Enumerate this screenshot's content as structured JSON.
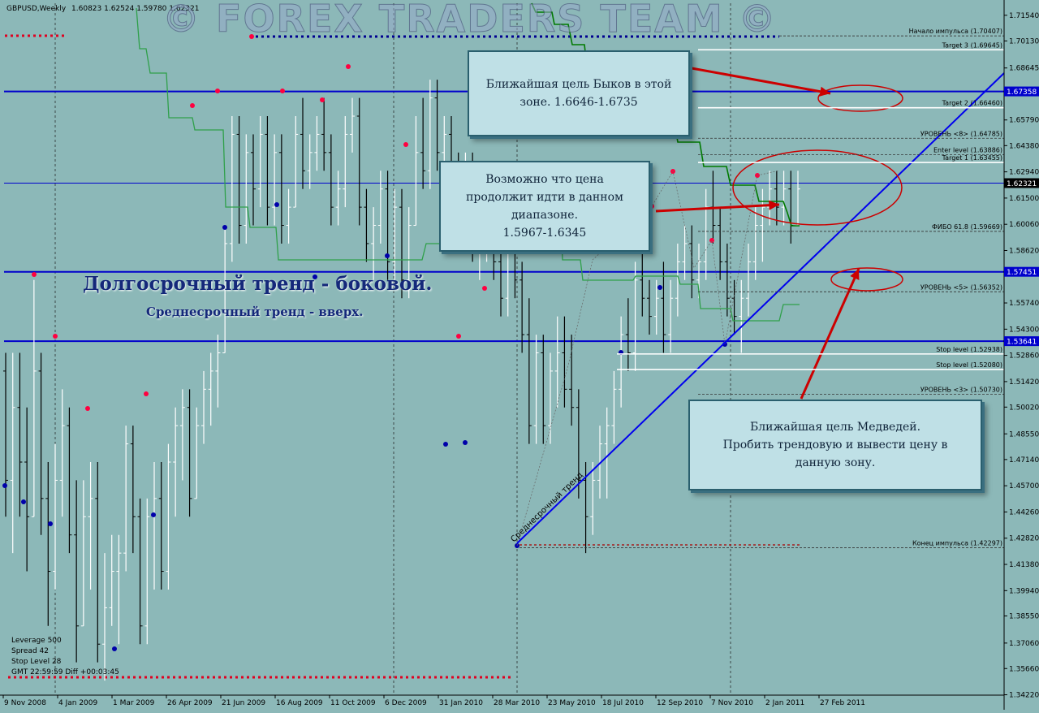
{
  "header": {
    "symbol": "GBPUSD,Weekly",
    "ohlc": "1.60823 1.62524 1.59780 1.62321",
    "watermark": "© FOREX TRADERS TEAM ©"
  },
  "info_panel": [
    "Leverage 500",
    "Spread 42",
    "Stop Level 28",
    "GMT 22:59:59 Diff +00:03:45"
  ],
  "annotations": {
    "long_term": "Долгосрочный тренд - боковой.",
    "mid_term": "Среднесрочный тренд - вверх.",
    "trend_label": "Среднесрочный тренд",
    "callout_bulls": [
      "Ближайшая цель Быков в этой",
      "зоне. 1.6646-1.6735"
    ],
    "callout_range": [
      "Возможно что цена",
      "продолжит идти в данном",
      "диапазоне.",
      "1.5967-1.6345"
    ],
    "callout_bears": [
      "Ближайшая цель Медведей.",
      "Пробить трендовую и вывести цену в",
      "данную зону."
    ]
  },
  "colors": {
    "background": "#8cb8b8",
    "level_line": "#0000cc",
    "trend_line": "#0000ee",
    "green_line": "#2fa04a",
    "dark_green": "#007a00",
    "red_dot": "#ff0040",
    "arrow": "#cc0000",
    "current_price_bg": "#000080"
  },
  "chart_data": {
    "type": "bar",
    "ylim": [
      1.342,
      1.722
    ],
    "y_ticks": [
      "1.71540",
      "1.70130",
      "1.68645",
      "1.67358",
      "1.65790",
      "1.64380",
      "1.62940",
      "1.62321",
      "1.61500",
      "1.60060",
      "1.58620",
      "1.57451",
      "1.55740",
      "1.54300",
      "1.53641",
      "1.52860",
      "1.51420",
      "1.50020",
      "1.48550",
      "1.47140",
      "1.45700",
      "1.44260",
      "1.42820",
      "1.41380",
      "1.39940",
      "1.38550",
      "1.37060",
      "1.35660",
      "1.34220"
    ],
    "x_ticks": [
      "9 Nov 2008",
      "4 Jan 2009",
      "1 Mar 2009",
      "26 Apr 2009",
      "21 Jun 2009",
      "16 Aug 2009",
      "11 Oct 2009",
      "6 Dec 2009",
      "31 Jan 2010",
      "28 Mar 2010",
      "23 May 2010",
      "18 Jul 2010",
      "12 Sep 2010",
      "7 Nov 2010",
      "2 Jan 2011",
      "27 Feb 2011"
    ],
    "price_boxes": [
      {
        "value": 1.67358,
        "label": "1.67358"
      },
      {
        "value": 1.62321,
        "label": "1.62321"
      },
      {
        "value": 1.57451,
        "label": "1.57451"
      },
      {
        "value": 1.53641,
        "label": "1.53641"
      }
    ],
    "horizontal_levels": [
      {
        "value": 1.67358,
        "style": "solid-blue"
      },
      {
        "value": 1.57451,
        "style": "solid-blue"
      },
      {
        "value": 1.53641,
        "style": "solid-blue"
      },
      {
        "value": 1.62321,
        "style": "thin-blue"
      }
    ],
    "fib_levels": [
      {
        "value": 1.70407,
        "label": "Начало импульса",
        "price": "(1.70407)"
      },
      {
        "value": 1.69645,
        "label": "Target 3",
        "price": "(1.69645)"
      },
      {
        "value": 1.6646,
        "label": "Target 2",
        "price": "(1.66460)"
      },
      {
        "value": 1.64785,
        "label": "УРОВЕНЬ <8>",
        "price": "(1.64785)"
      },
      {
        "value": 1.63886,
        "label": "Enter level",
        "price": "(1.63886)"
      },
      {
        "value": 1.63455,
        "label": "Target 1",
        "price": "(1.63455)"
      },
      {
        "value": 1.59669,
        "label": "ФИБО 61.8",
        "price": "(1.59669)"
      },
      {
        "value": 1.56352,
        "label": "УРОВЕНЬ <5>",
        "price": "(1.56352)"
      },
      {
        "value": 1.52938,
        "label": "Stop level",
        "price": "(1.52938)"
      },
      {
        "value": 1.5208,
        "label": "Stop level",
        "price": "(1.52080)"
      },
      {
        "value": 1.5073,
        "label": "УРОВЕНЬ <3>",
        "price": "(1.50730)"
      },
      {
        "value": 1.42297,
        "label": "Конец импульса",
        "price": "(1.42297)"
      }
    ],
    "ohlc_bars": [
      [
        1.52,
        1.53,
        1.44,
        1.46
      ],
      [
        1.46,
        1.53,
        1.42,
        1.5
      ],
      [
        1.5,
        1.53,
        1.44,
        1.47
      ],
      [
        1.47,
        1.5,
        1.41,
        1.44
      ],
      [
        1.44,
        1.57,
        1.44,
        1.52
      ],
      [
        1.52,
        1.53,
        1.43,
        1.45
      ],
      [
        1.45,
        1.47,
        1.38,
        1.41
      ],
      [
        1.41,
        1.48,
        1.4,
        1.46
      ],
      [
        1.46,
        1.51,
        1.44,
        1.49
      ],
      [
        1.49,
        1.5,
        1.42,
        1.43
      ],
      [
        1.43,
        1.46,
        1.36,
        1.38
      ],
      [
        1.38,
        1.46,
        1.38,
        1.44
      ],
      [
        1.44,
        1.47,
        1.4,
        1.45
      ],
      [
        1.45,
        1.47,
        1.36,
        1.37
      ],
      [
        1.37,
        1.42,
        1.35,
        1.39
      ],
      [
        1.39,
        1.43,
        1.38,
        1.41
      ],
      [
        1.41,
        1.43,
        1.37,
        1.42
      ],
      [
        1.42,
        1.49,
        1.41,
        1.48
      ],
      [
        1.48,
        1.49,
        1.42,
        1.44
      ],
      [
        1.44,
        1.45,
        1.37,
        1.38
      ],
      [
        1.38,
        1.45,
        1.37,
        1.44
      ],
      [
        1.44,
        1.47,
        1.4,
        1.45
      ],
      [
        1.45,
        1.47,
        1.4,
        1.41
      ],
      [
        1.41,
        1.48,
        1.4,
        1.47
      ],
      [
        1.47,
        1.5,
        1.44,
        1.49
      ],
      [
        1.49,
        1.51,
        1.46,
        1.5
      ],
      [
        1.5,
        1.51,
        1.44,
        1.45
      ],
      [
        1.45,
        1.5,
        1.45,
        1.49
      ],
      [
        1.49,
        1.52,
        1.48,
        1.51
      ],
      [
        1.51,
        1.53,
        1.49,
        1.52
      ],
      [
        1.52,
        1.54,
        1.5,
        1.53
      ],
      [
        1.53,
        1.6,
        1.53,
        1.59
      ],
      [
        1.59,
        1.66,
        1.58,
        1.65
      ],
      [
        1.65,
        1.66,
        1.59,
        1.6
      ],
      [
        1.6,
        1.65,
        1.59,
        1.64
      ],
      [
        1.64,
        1.65,
        1.6,
        1.62
      ],
      [
        1.62,
        1.66,
        1.61,
        1.65
      ],
      [
        1.65,
        1.66,
        1.6,
        1.61
      ],
      [
        1.61,
        1.65,
        1.6,
        1.64
      ],
      [
        1.64,
        1.65,
        1.59,
        1.6
      ],
      [
        1.6,
        1.62,
        1.59,
        1.61
      ],
      [
        1.61,
        1.66,
        1.61,
        1.65
      ],
      [
        1.65,
        1.67,
        1.62,
        1.63
      ],
      [
        1.63,
        1.65,
        1.62,
        1.64
      ],
      [
        1.64,
        1.66,
        1.63,
        1.65
      ],
      [
        1.65,
        1.67,
        1.63,
        1.64
      ],
      [
        1.64,
        1.65,
        1.6,
        1.61
      ],
      [
        1.61,
        1.63,
        1.6,
        1.62
      ],
      [
        1.62,
        1.66,
        1.61,
        1.65
      ],
      [
        1.65,
        1.67,
        1.64,
        1.66
      ],
      [
        1.66,
        1.67,
        1.6,
        1.61
      ],
      [
        1.61,
        1.62,
        1.58,
        1.59
      ],
      [
        1.59,
        1.61,
        1.57,
        1.6
      ],
      [
        1.6,
        1.63,
        1.59,
        1.62
      ],
      [
        1.62,
        1.63,
        1.57,
        1.58
      ],
      [
        1.58,
        1.62,
        1.57,
        1.61
      ],
      [
        1.61,
        1.62,
        1.56,
        1.57
      ],
      [
        1.57,
        1.61,
        1.56,
        1.6
      ],
      [
        1.6,
        1.66,
        1.6,
        1.64
      ],
      [
        1.64,
        1.67,
        1.62,
        1.63
      ],
      [
        1.63,
        1.68,
        1.62,
        1.67
      ],
      [
        1.67,
        1.68,
        1.63,
        1.64
      ],
      [
        1.64,
        1.66,
        1.63,
        1.65
      ],
      [
        1.65,
        1.66,
        1.62,
        1.63
      ],
      [
        1.63,
        1.64,
        1.6,
        1.61
      ],
      [
        1.61,
        1.64,
        1.6,
        1.63
      ],
      [
        1.63,
        1.64,
        1.58,
        1.59
      ],
      [
        1.59,
        1.61,
        1.57,
        1.6
      ],
      [
        1.6,
        1.62,
        1.58,
        1.61
      ],
      [
        1.61,
        1.62,
        1.57,
        1.58
      ],
      [
        1.58,
        1.59,
        1.55,
        1.56
      ],
      [
        1.56,
        1.6,
        1.55,
        1.59
      ],
      [
        1.59,
        1.6,
        1.56,
        1.57
      ],
      [
        1.57,
        1.58,
        1.53,
        1.54
      ],
      [
        1.54,
        1.56,
        1.48,
        1.49
      ],
      [
        1.49,
        1.54,
        1.48,
        1.53
      ],
      [
        1.53,
        1.54,
        1.48,
        1.49
      ],
      [
        1.49,
        1.53,
        1.48,
        1.52
      ],
      [
        1.52,
        1.55,
        1.5,
        1.53
      ],
      [
        1.53,
        1.55,
        1.5,
        1.51
      ],
      [
        1.51,
        1.54,
        1.49,
        1.5
      ],
      [
        1.5,
        1.51,
        1.45,
        1.46
      ],
      [
        1.46,
        1.47,
        1.42,
        1.44
      ],
      [
        1.44,
        1.47,
        1.43,
        1.46
      ],
      [
        1.46,
        1.49,
        1.45,
        1.48
      ],
      [
        1.48,
        1.5,
        1.45,
        1.49
      ],
      [
        1.49,
        1.52,
        1.48,
        1.51
      ],
      [
        1.51,
        1.55,
        1.5,
        1.54
      ],
      [
        1.54,
        1.56,
        1.52,
        1.53
      ],
      [
        1.53,
        1.58,
        1.52,
        1.57
      ],
      [
        1.57,
        1.59,
        1.55,
        1.56
      ],
      [
        1.56,
        1.57,
        1.54,
        1.55
      ],
      [
        1.55,
        1.57,
        1.54,
        1.56
      ],
      [
        1.56,
        1.58,
        1.53,
        1.54
      ],
      [
        1.54,
        1.57,
        1.53,
        1.56
      ],
      [
        1.56,
        1.59,
        1.55,
        1.58
      ],
      [
        1.58,
        1.6,
        1.57,
        1.59
      ],
      [
        1.59,
        1.6,
        1.56,
        1.57
      ],
      [
        1.57,
        1.59,
        1.56,
        1.58
      ],
      [
        1.58,
        1.62,
        1.57,
        1.61
      ],
      [
        1.61,
        1.63,
        1.59,
        1.6
      ],
      [
        1.6,
        1.61,
        1.57,
        1.58
      ],
      [
        1.58,
        1.59,
        1.55,
        1.56
      ],
      [
        1.56,
        1.57,
        1.54,
        1.55
      ],
      [
        1.55,
        1.57,
        1.53,
        1.56
      ],
      [
        1.56,
        1.59,
        1.55,
        1.58
      ],
      [
        1.58,
        1.61,
        1.57,
        1.6
      ],
      [
        1.6,
        1.62,
        1.58,
        1.61
      ],
      [
        1.61,
        1.63,
        1.6,
        1.62
      ],
      [
        1.62,
        1.63,
        1.6,
        1.61
      ],
      [
        1.61,
        1.63,
        1.6,
        1.62
      ],
      [
        1.62,
        1.63,
        1.59,
        1.6
      ],
      [
        1.6,
        1.63,
        1.6,
        1.62
      ]
    ]
  }
}
